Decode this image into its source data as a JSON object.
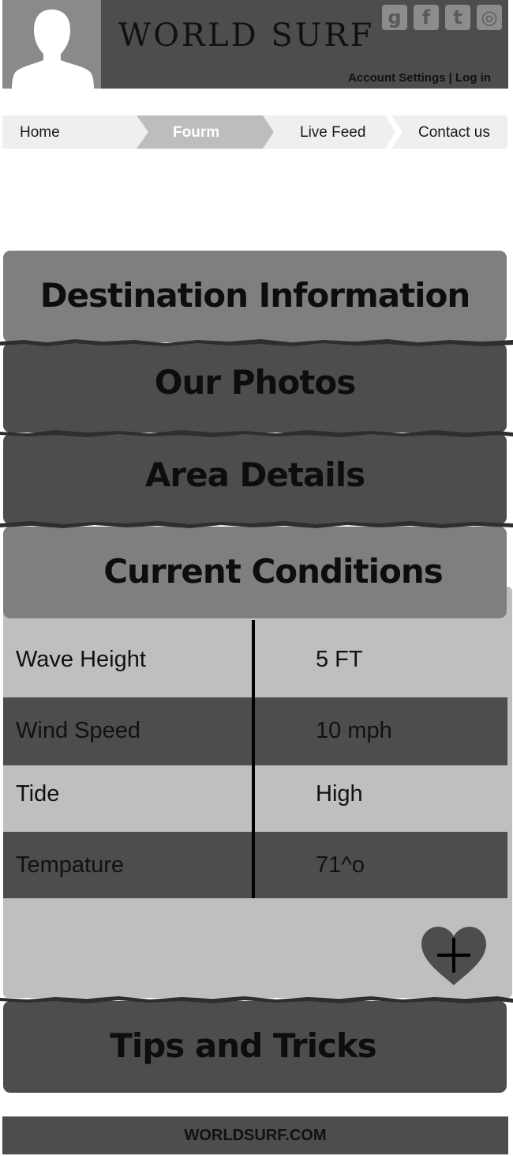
{
  "header": {
    "brand": "WORLD SURF",
    "social": {
      "google": "g",
      "facebook": "f",
      "twitter": "t",
      "instagram": "◎"
    },
    "account_settings": "Account Settings",
    "separator": "|",
    "log_in": "Log in"
  },
  "nav": {
    "items": [
      {
        "label": "Home",
        "active": false
      },
      {
        "label": "Fourm",
        "active": true
      },
      {
        "label": "Live Feed",
        "active": false
      },
      {
        "label": "Contact us",
        "active": false
      }
    ]
  },
  "sections": {
    "destination": "Destination Information",
    "photos": "Our Photos",
    "area": "Area Details",
    "conditions": "Current Conditions",
    "tips": "Tips and Tricks"
  },
  "conditions": {
    "rows": [
      {
        "label": "Wave Height",
        "value": "5 FT"
      },
      {
        "label": "Wind Speed",
        "value": "10 mph"
      },
      {
        "label": "Tide",
        "value": "High"
      },
      {
        "label": "Tempature",
        "value": "71^o"
      }
    ],
    "favorite_icon": "heart-plus-icon"
  },
  "footer": {
    "text": "WORLDSURF.COM"
  },
  "colors": {
    "dark_gray": "#4d4d4d",
    "mid_gray": "#7f7f7f",
    "light_gray": "#bfbfbf",
    "nav_active": "#bdbdbd",
    "nav_inactive": "#efefef"
  }
}
